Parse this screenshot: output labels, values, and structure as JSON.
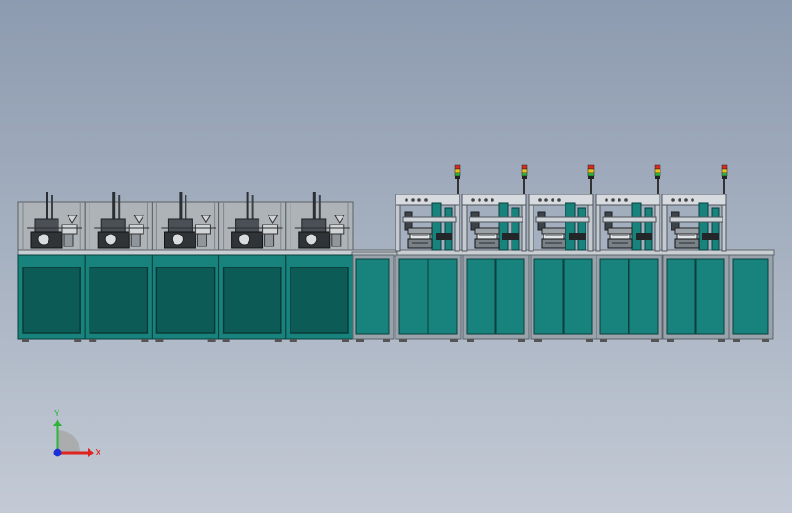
{
  "view": {
    "background_top": "#8d9bb0",
    "background_bottom": "#c3cad5"
  },
  "machine": {
    "cabinet_color": "#17837c",
    "cabinet_dark": "#0f5f5a",
    "panel_color": "#0d5b57",
    "frame_color": "#9aa3ab",
    "frame_dark": "#5d656c",
    "left_section": {
      "stations": 5
    },
    "right_section": {
      "stations": 5
    },
    "signal_towers": 5,
    "tower_colors": [
      "#d62b1f",
      "#e8c21a",
      "#2fae3c"
    ]
  },
  "triad": {
    "x_label": "X",
    "y_label": "Y",
    "x_color": "#e0231c",
    "y_color": "#2fb33a",
    "z_color": "#1f2fd8"
  }
}
